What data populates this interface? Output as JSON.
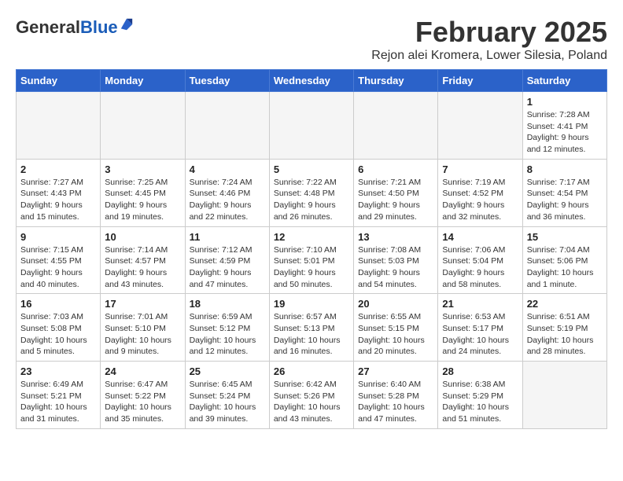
{
  "logo": {
    "general": "General",
    "blue": "Blue"
  },
  "title": "February 2025",
  "subtitle": "Rejon alei Kromera, Lower Silesia, Poland",
  "days_of_week": [
    "Sunday",
    "Monday",
    "Tuesday",
    "Wednesday",
    "Thursday",
    "Friday",
    "Saturday"
  ],
  "weeks": [
    [
      {
        "day": "",
        "info": ""
      },
      {
        "day": "",
        "info": ""
      },
      {
        "day": "",
        "info": ""
      },
      {
        "day": "",
        "info": ""
      },
      {
        "day": "",
        "info": ""
      },
      {
        "day": "",
        "info": ""
      },
      {
        "day": "1",
        "info": "Sunrise: 7:28 AM\nSunset: 4:41 PM\nDaylight: 9 hours and 12 minutes."
      }
    ],
    [
      {
        "day": "2",
        "info": "Sunrise: 7:27 AM\nSunset: 4:43 PM\nDaylight: 9 hours and 15 minutes."
      },
      {
        "day": "3",
        "info": "Sunrise: 7:25 AM\nSunset: 4:45 PM\nDaylight: 9 hours and 19 minutes."
      },
      {
        "day": "4",
        "info": "Sunrise: 7:24 AM\nSunset: 4:46 PM\nDaylight: 9 hours and 22 minutes."
      },
      {
        "day": "5",
        "info": "Sunrise: 7:22 AM\nSunset: 4:48 PM\nDaylight: 9 hours and 26 minutes."
      },
      {
        "day": "6",
        "info": "Sunrise: 7:21 AM\nSunset: 4:50 PM\nDaylight: 9 hours and 29 minutes."
      },
      {
        "day": "7",
        "info": "Sunrise: 7:19 AM\nSunset: 4:52 PM\nDaylight: 9 hours and 32 minutes."
      },
      {
        "day": "8",
        "info": "Sunrise: 7:17 AM\nSunset: 4:54 PM\nDaylight: 9 hours and 36 minutes."
      }
    ],
    [
      {
        "day": "9",
        "info": "Sunrise: 7:15 AM\nSunset: 4:55 PM\nDaylight: 9 hours and 40 minutes."
      },
      {
        "day": "10",
        "info": "Sunrise: 7:14 AM\nSunset: 4:57 PM\nDaylight: 9 hours and 43 minutes."
      },
      {
        "day": "11",
        "info": "Sunrise: 7:12 AM\nSunset: 4:59 PM\nDaylight: 9 hours and 47 minutes."
      },
      {
        "day": "12",
        "info": "Sunrise: 7:10 AM\nSunset: 5:01 PM\nDaylight: 9 hours and 50 minutes."
      },
      {
        "day": "13",
        "info": "Sunrise: 7:08 AM\nSunset: 5:03 PM\nDaylight: 9 hours and 54 minutes."
      },
      {
        "day": "14",
        "info": "Sunrise: 7:06 AM\nSunset: 5:04 PM\nDaylight: 9 hours and 58 minutes."
      },
      {
        "day": "15",
        "info": "Sunrise: 7:04 AM\nSunset: 5:06 PM\nDaylight: 10 hours and 1 minute."
      }
    ],
    [
      {
        "day": "16",
        "info": "Sunrise: 7:03 AM\nSunset: 5:08 PM\nDaylight: 10 hours and 5 minutes."
      },
      {
        "day": "17",
        "info": "Sunrise: 7:01 AM\nSunset: 5:10 PM\nDaylight: 10 hours and 9 minutes."
      },
      {
        "day": "18",
        "info": "Sunrise: 6:59 AM\nSunset: 5:12 PM\nDaylight: 10 hours and 12 minutes."
      },
      {
        "day": "19",
        "info": "Sunrise: 6:57 AM\nSunset: 5:13 PM\nDaylight: 10 hours and 16 minutes."
      },
      {
        "day": "20",
        "info": "Sunrise: 6:55 AM\nSunset: 5:15 PM\nDaylight: 10 hours and 20 minutes."
      },
      {
        "day": "21",
        "info": "Sunrise: 6:53 AM\nSunset: 5:17 PM\nDaylight: 10 hours and 24 minutes."
      },
      {
        "day": "22",
        "info": "Sunrise: 6:51 AM\nSunset: 5:19 PM\nDaylight: 10 hours and 28 minutes."
      }
    ],
    [
      {
        "day": "23",
        "info": "Sunrise: 6:49 AM\nSunset: 5:21 PM\nDaylight: 10 hours and 31 minutes."
      },
      {
        "day": "24",
        "info": "Sunrise: 6:47 AM\nSunset: 5:22 PM\nDaylight: 10 hours and 35 minutes."
      },
      {
        "day": "25",
        "info": "Sunrise: 6:45 AM\nSunset: 5:24 PM\nDaylight: 10 hours and 39 minutes."
      },
      {
        "day": "26",
        "info": "Sunrise: 6:42 AM\nSunset: 5:26 PM\nDaylight: 10 hours and 43 minutes."
      },
      {
        "day": "27",
        "info": "Sunrise: 6:40 AM\nSunset: 5:28 PM\nDaylight: 10 hours and 47 minutes."
      },
      {
        "day": "28",
        "info": "Sunrise: 6:38 AM\nSunset: 5:29 PM\nDaylight: 10 hours and 51 minutes."
      },
      {
        "day": "",
        "info": ""
      }
    ]
  ]
}
